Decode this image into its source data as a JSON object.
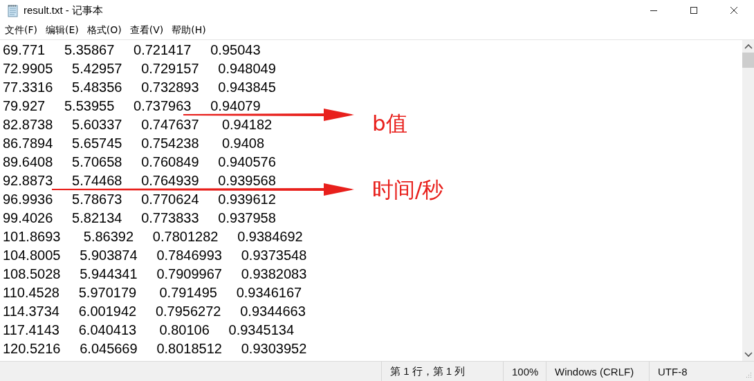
{
  "window": {
    "title": "result.txt - 记事本"
  },
  "menu": [
    "文件(F)",
    "编辑(E)",
    "格式(O)",
    "查看(V)",
    "帮助(H)"
  ],
  "lines": [
    "69.771     5.35867     0.721417     0.95043",
    "72.9905     5.42957     0.729157     0.948049",
    "77.3316     5.48356     0.732893     0.943845",
    "79.927     5.53955     0.737963     0.94079",
    "82.8738     5.60337     0.747637      0.94182",
    "86.7894     5.65745     0.754238      0.9408",
    "89.6408     5.70658     0.760849     0.940576",
    "92.8873     5.74468     0.764939     0.939568",
    "96.9936     5.78673     0.770624     0.939612",
    "99.4026     5.82134     0.773833     0.937958",
    "101.8693      5.86392     0.7801282     0.9384692",
    "104.8005     5.903874     0.7846993     0.9373548",
    "108.5028     5.944341     0.7909967     0.9382083",
    "110.4528     5.970179      0.791495     0.9346167",
    "114.3734     6.001942     0.7956272     0.9344663",
    "117.4143     6.040413      0.80106     0.9345134",
    "120.5216     6.045669     0.8018512     0.9303952"
  ],
  "annotations": [
    {
      "label": "b值"
    },
    {
      "label": "时间/秒"
    }
  ],
  "status_bar": [
    "第 1 行，第 1 列",
    "100%",
    "Windows (CRLF)",
    "UTF-8"
  ]
}
